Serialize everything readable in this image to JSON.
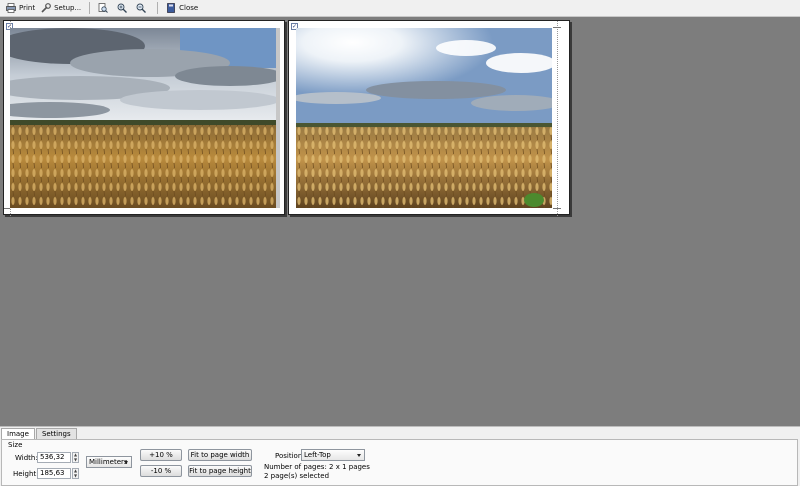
{
  "toolbar": {
    "print_label": "Print",
    "setup_label": "Setup...",
    "close_label": "Close"
  },
  "tabs": [
    {
      "label": "Image",
      "active": true
    },
    {
      "label": "Settings",
      "active": false
    }
  ],
  "size": {
    "section_label": "Size",
    "width_label": "Width:",
    "width_value": "536,32",
    "height_label": "Height:",
    "height_value": "185,63",
    "unit_selected": "Millimeters"
  },
  "zoom_buttons": {
    "plus": "+10 %",
    "minus": "-10 %"
  },
  "fit_buttons": {
    "width": "Fit to page width",
    "height": "Fit to page height"
  },
  "position": {
    "label": "Position:",
    "selected": "Left-Top"
  },
  "info": {
    "pages": "Number of pages: 2 x 1 pages",
    "selected": "2 page(s) selected"
  },
  "colors": {
    "preview_bg": "#7d7d7d",
    "sky": "#6f95c4",
    "wheat": "#b98a3c"
  },
  "icons": {
    "print": "printer-icon",
    "setup": "wrench-icon",
    "zoom_page": "page-zoom-icon",
    "zoom_in": "zoom-in-icon",
    "zoom_out": "zoom-out-icon",
    "close": "close-book-icon"
  }
}
